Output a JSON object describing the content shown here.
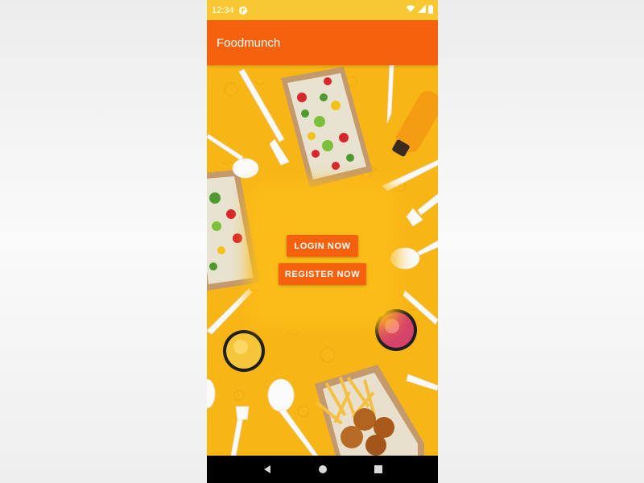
{
  "status_bar": {
    "time": "12:34",
    "notification_icon": "app-notification-icon",
    "wifi_icon": "wifi-icon",
    "signal_icon": "cell-signal-icon",
    "battery_icon": "battery-icon"
  },
  "app_bar": {
    "title": "Foodmunch",
    "color": "#f5610c"
  },
  "background": {
    "description_icon": "food-illustration",
    "color": "#f8b616"
  },
  "actions": {
    "login_label": "LOGIN NOW",
    "register_label": "REGISTER NOW",
    "button_color": "#f5610c"
  },
  "nav_bar": {
    "back_icon": "back-triangle-icon",
    "home_icon": "home-circle-icon",
    "recents_icon": "recents-square-icon"
  }
}
